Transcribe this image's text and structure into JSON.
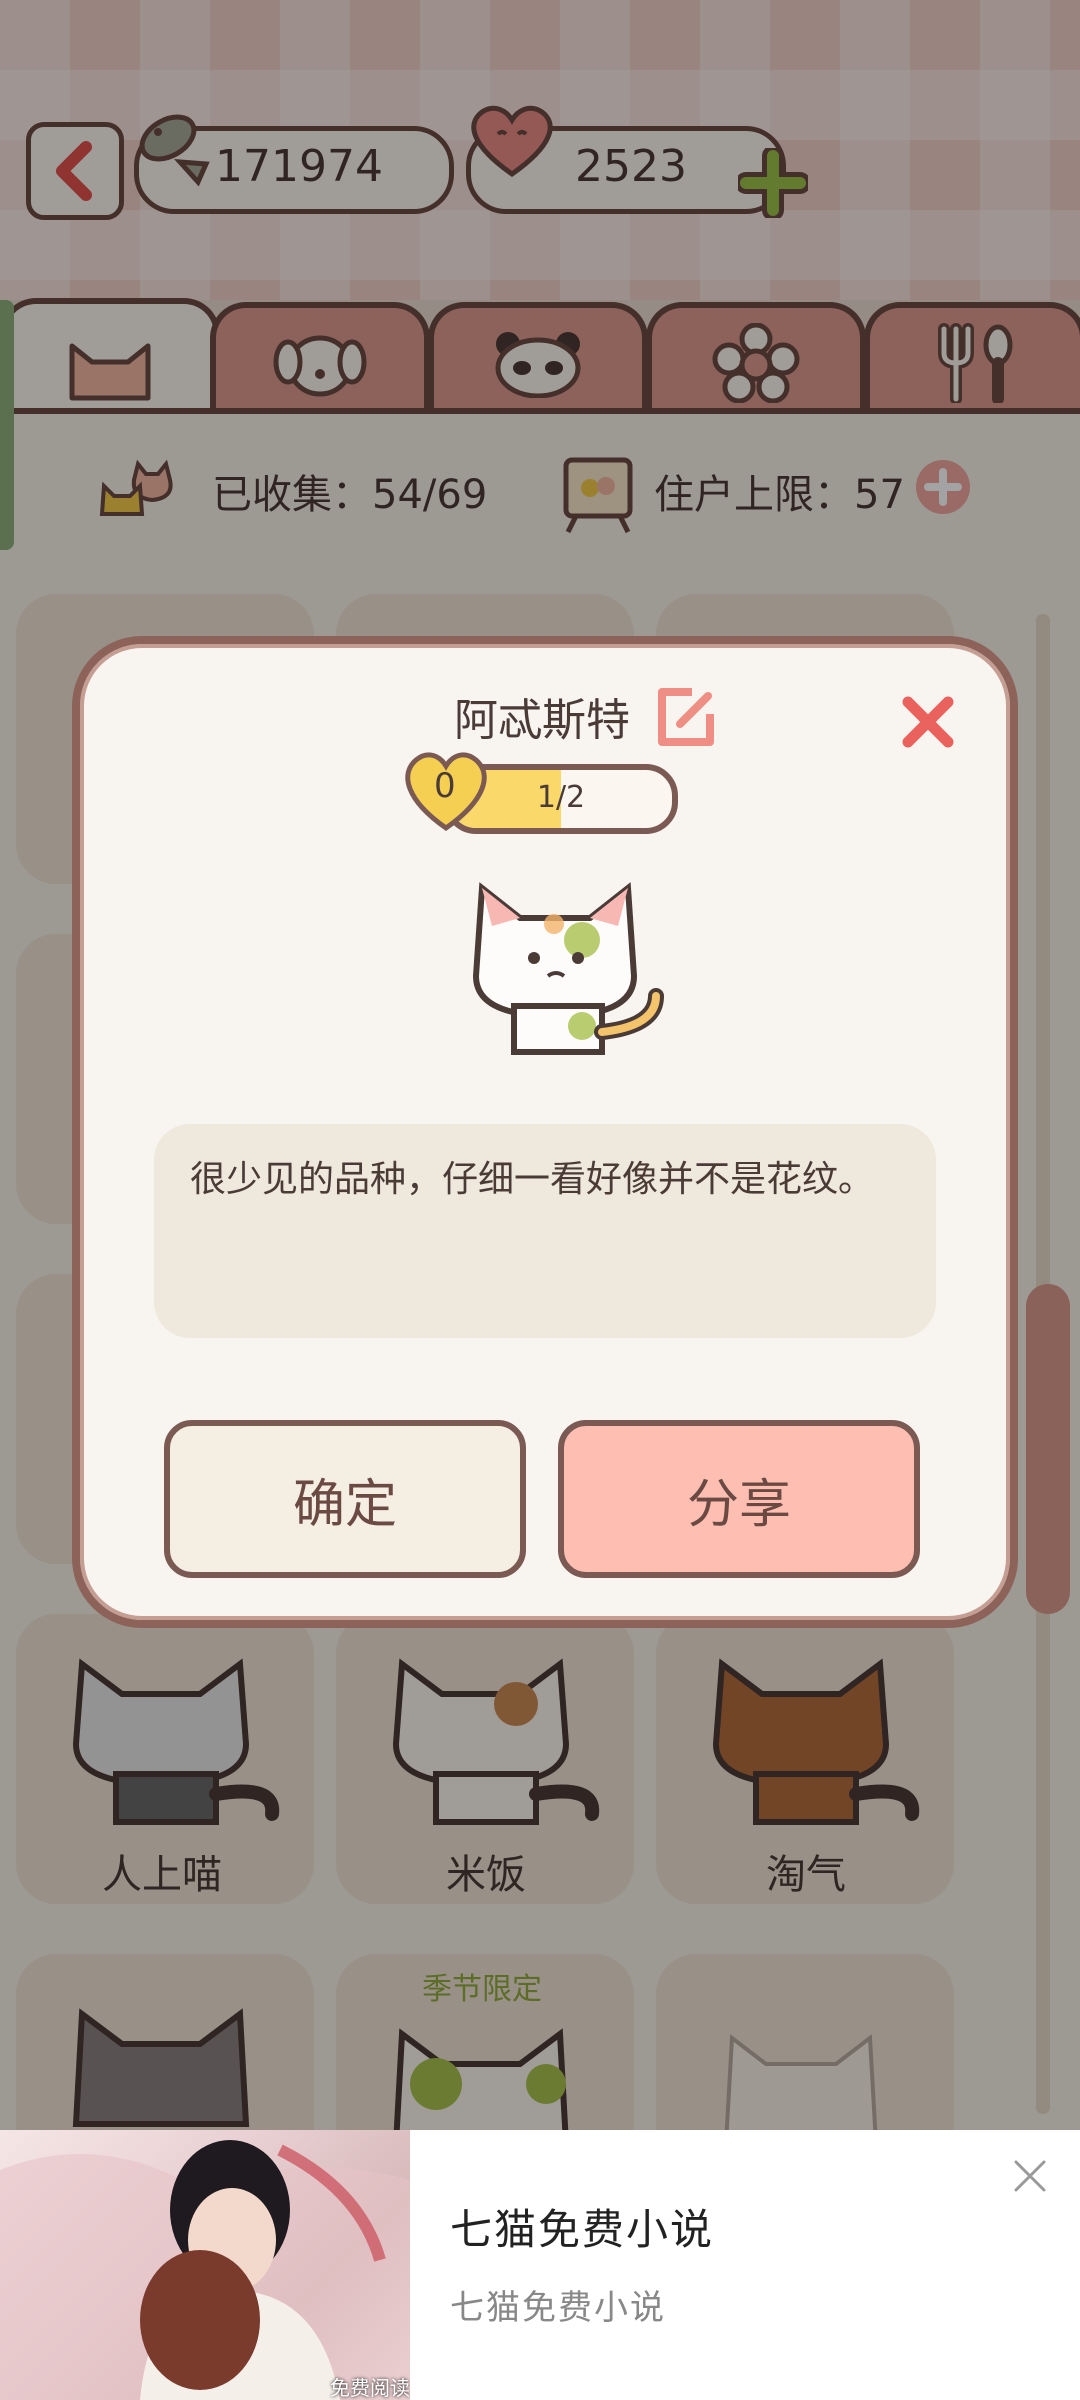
{
  "header": {
    "fish_count": "171974",
    "heart_count": "2523"
  },
  "stats": {
    "collected": "已收集：54/69",
    "capacity": "住户上限：57"
  },
  "grid": {
    "row1": [
      "人上喵",
      "米饭",
      "淘气"
    ],
    "seasonal_tag": "季节限定"
  },
  "dialog": {
    "cat_name": "阿忒斯特",
    "heart_level": "0",
    "progress_text": "1/2",
    "progress_fraction": 0.5,
    "description": "很少见的品种，仔细一看好像并不是花纹。",
    "confirm_label": "确定",
    "share_label": "分享"
  },
  "ad": {
    "title": "七猫免费小说",
    "subtitle": "七猫免费小说",
    "image_caption": "免费阅读"
  },
  "colors": {
    "accent": "#e36f6a",
    "border": "#6b4a44",
    "share_button": "#ffbeb2",
    "confirm_button": "#f5eee2",
    "progress_fill": "#fbd86a"
  }
}
